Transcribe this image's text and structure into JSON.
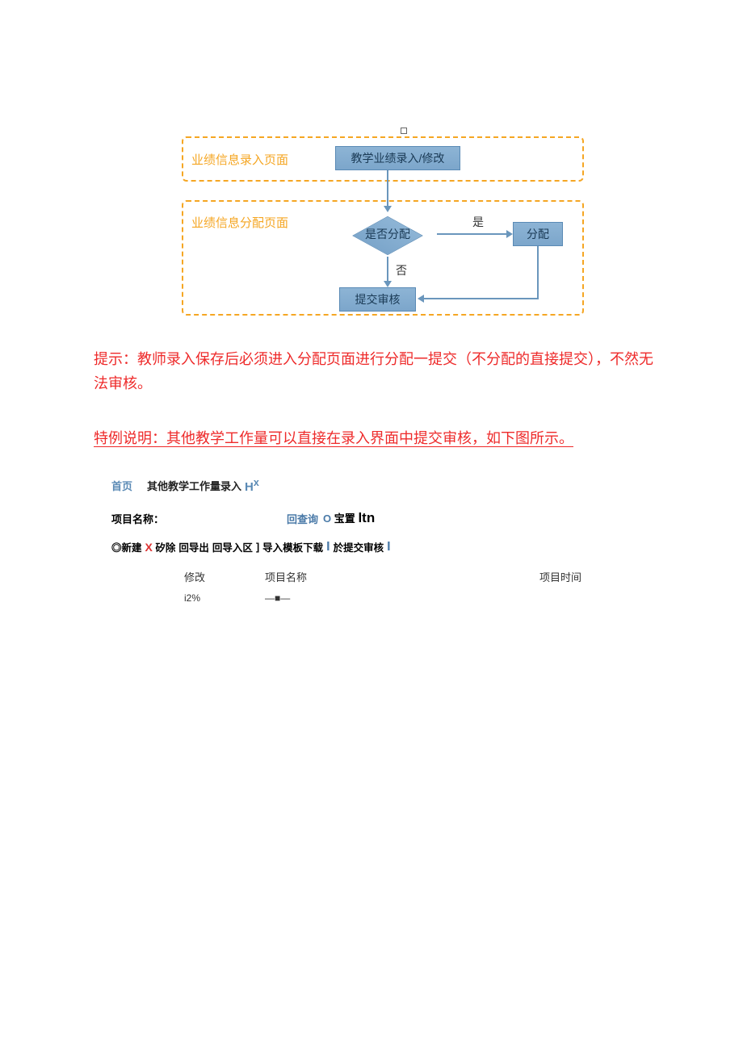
{
  "diagram": {
    "group1_label": "业绩信息录入页面",
    "group2_label": "业绩信息分配页面",
    "box_input": "教学业绩录入/修改",
    "decision": "是否分配",
    "yes": "是",
    "no": "否",
    "box_dist": "分配",
    "box_submit": "提交审核"
  },
  "paragraphs": {
    "tip": "提示：教师录入保存后必须进入分配页面进行分配一提交（不分配的直接提交），不然无法审核。",
    "special": "特例说明：其他教学工作量可以直接在录入界面中提交审核，如下图所示。"
  },
  "ui": {
    "breadcrumb_home": "首页",
    "breadcrumb_current": "其他教学工作量录入",
    "breadcrumb_close_glyph": "H",
    "breadcrumb_close_sup": "x",
    "search_label": "项目名称：",
    "btn_query_icon": "回",
    "btn_query": "查询",
    "btn_reset_icon": "O",
    "btn_reset": "宝置",
    "btn_reset_extra": "ltn",
    "toolbar": {
      "new_icon": "◎",
      "new": "新建",
      "del_icon": "X",
      "del": "矽除",
      "export_icon": "回",
      "export": "导出",
      "import_icon": "回",
      "import": "导入区",
      "import_bracket": "]",
      "template": "导入模板下载",
      "template_bar": "I",
      "submit": "於提交审核",
      "submit_bar": "I"
    },
    "table": {
      "head_modify": "修改",
      "head_name": "项目名称",
      "head_time": "项目时间",
      "row1_modify": "i2%",
      "row1_name": "—■—"
    }
  }
}
